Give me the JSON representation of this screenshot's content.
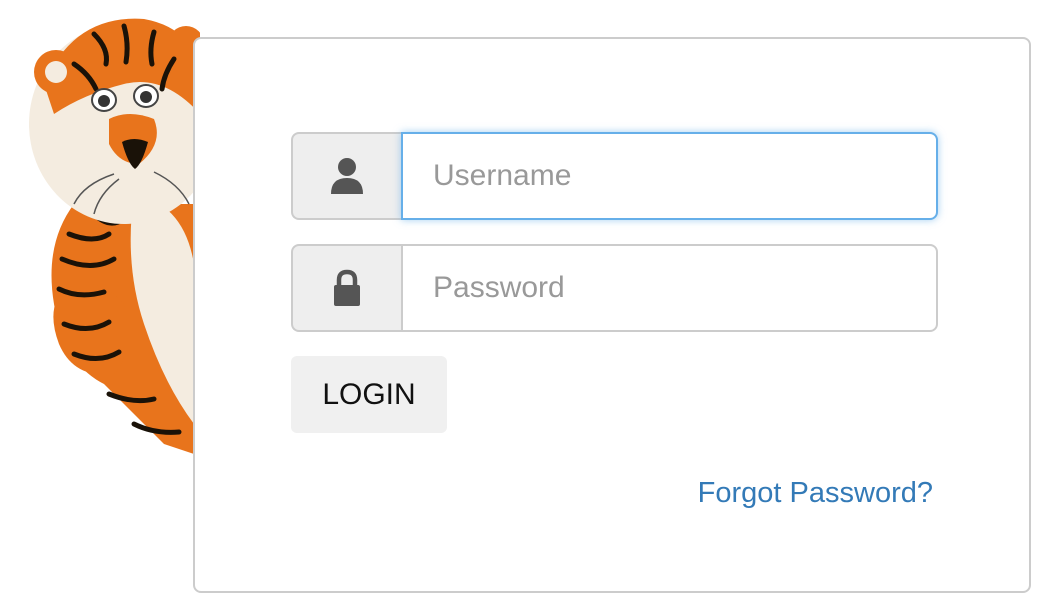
{
  "username": {
    "placeholder": "Username",
    "value": "",
    "icon": "user-icon"
  },
  "password": {
    "placeholder": "Password",
    "value": "",
    "icon": "lock-icon"
  },
  "login_button": {
    "label": "LOGIN"
  },
  "forgot_link": {
    "label": "Forgot Password?"
  },
  "colors": {
    "link": "#337ab7",
    "focus_border": "#66afe9",
    "addon_bg": "#eeeeee",
    "button_bg": "#f0f0f0",
    "mascot_orange": "#e8741c"
  }
}
